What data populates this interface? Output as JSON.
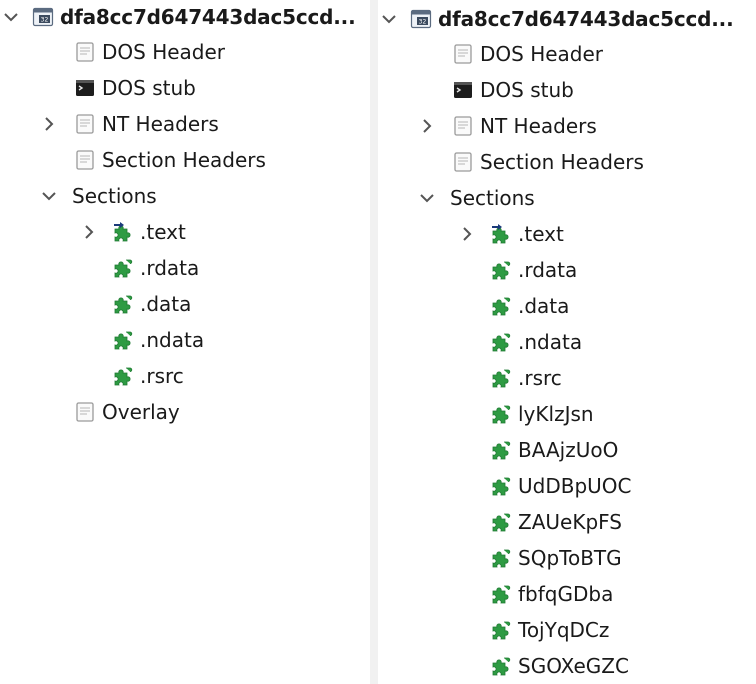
{
  "panes": [
    {
      "root_label": "dfa8cc7d647443dac5ccd...",
      "items": [
        {
          "label": "DOS Header",
          "icon": "document-icon"
        },
        {
          "label": "DOS stub",
          "icon": "console-icon"
        },
        {
          "label": "NT Headers",
          "icon": "document-icon",
          "collapsible": "collapsed"
        },
        {
          "label": "Section Headers",
          "icon": "document-icon"
        },
        {
          "label": "Sections",
          "icon": "none",
          "collapsible": "expanded"
        },
        {
          "label": ".text",
          "icon": "puzzle-entry-icon",
          "collapsible": "collapsed",
          "child": true
        },
        {
          "label": ".rdata",
          "icon": "puzzle-icon",
          "child": true
        },
        {
          "label": ".data",
          "icon": "puzzle-icon",
          "child": true
        },
        {
          "label": ".ndata",
          "icon": "puzzle-icon",
          "child": true
        },
        {
          "label": ".rsrc",
          "icon": "puzzle-icon",
          "child": true
        },
        {
          "label": "Overlay",
          "icon": "document-icon"
        }
      ]
    },
    {
      "root_label": "dfa8cc7d647443dac5ccd...",
      "items": [
        {
          "label": "DOS Header",
          "icon": "document-icon"
        },
        {
          "label": "DOS stub",
          "icon": "console-icon"
        },
        {
          "label": "NT Headers",
          "icon": "document-icon",
          "collapsible": "collapsed"
        },
        {
          "label": "Section Headers",
          "icon": "document-icon"
        },
        {
          "label": "Sections",
          "icon": "none",
          "collapsible": "expanded"
        },
        {
          "label": ".text",
          "icon": "puzzle-entry-icon",
          "collapsible": "collapsed",
          "child": true
        },
        {
          "label": ".rdata",
          "icon": "puzzle-icon",
          "child": true
        },
        {
          "label": ".data",
          "icon": "puzzle-icon",
          "child": true
        },
        {
          "label": ".ndata",
          "icon": "puzzle-icon",
          "child": true
        },
        {
          "label": ".rsrc",
          "icon": "puzzle-icon",
          "child": true
        },
        {
          "label": "lyKlzJsn",
          "icon": "puzzle-icon",
          "child": true
        },
        {
          "label": "BAAjzUoO",
          "icon": "puzzle-icon",
          "child": true
        },
        {
          "label": "UdDBpUOC",
          "icon": "puzzle-icon",
          "child": true
        },
        {
          "label": "ZAUeKpFS",
          "icon": "puzzle-icon",
          "child": true
        },
        {
          "label": "SQpToBTG",
          "icon": "puzzle-icon",
          "child": true
        },
        {
          "label": "fbfqGDba",
          "icon": "puzzle-icon",
          "child": true
        },
        {
          "label": "TojYqDCz",
          "icon": "puzzle-icon",
          "child": true
        },
        {
          "label": "SGOXeGZC",
          "icon": "puzzle-icon",
          "child": true
        }
      ]
    }
  ],
  "colors": {
    "puzzle": "#2e9b43",
    "puzzle_dark": "#1f7a32",
    "chevron": "#555555",
    "doc": "#9a9a9a"
  }
}
